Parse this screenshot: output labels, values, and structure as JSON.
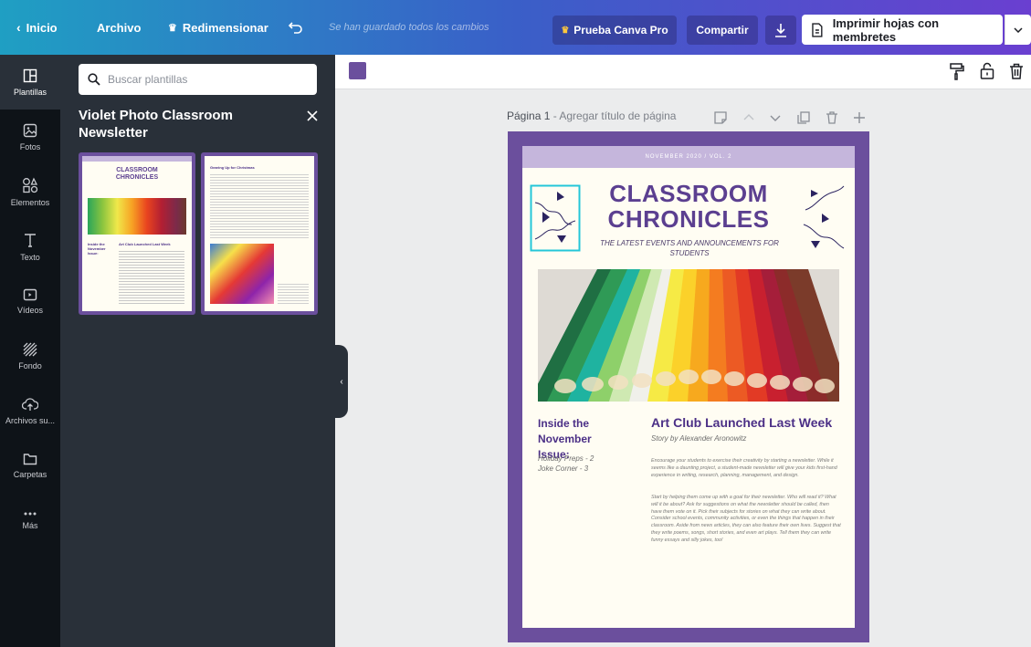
{
  "topbar": {
    "home_label": "Inicio",
    "file_label": "Archivo",
    "resize_label": "Redimensionar",
    "save_status": "Se han guardado todos los cambios",
    "pro_label": "Prueba Canva Pro",
    "share_label": "Compartir",
    "print_label": "Imprimir hojas con membretes"
  },
  "rail": {
    "items": [
      {
        "label": "Plantillas",
        "icon": "templates-icon"
      },
      {
        "label": "Fotos",
        "icon": "photos-icon"
      },
      {
        "label": "Elementos",
        "icon": "elements-icon"
      },
      {
        "label": "Texto",
        "icon": "text-icon"
      },
      {
        "label": "Vídeos",
        "icon": "videos-icon"
      },
      {
        "label": "Fondo",
        "icon": "background-icon"
      },
      {
        "label": "Archivos su...",
        "icon": "uploads-icon"
      },
      {
        "label": "Carpetas",
        "icon": "folders-icon"
      },
      {
        "label": "Más",
        "icon": "more-icon"
      }
    ]
  },
  "panel": {
    "search_placeholder": "Buscar plantillas",
    "title": "Violet Photo Classroom Newsletter",
    "thumb1": {
      "title": "CLASSROOM CHRONICLES",
      "col1": "Inside the November Issue:",
      "col2": "Art Club Launched Last Week"
    },
    "thumb2": {
      "title": "Gearing Up for Christmas"
    }
  },
  "canvas": {
    "page_label": "Página 1",
    "page_title_placeholder": " - Agregar título de página"
  },
  "newsletter": {
    "issue": "NOVEMBER 2020 / VOL. 2",
    "title_line1": "CLASSROOM",
    "title_line2": "CHRONICLES",
    "subtitle": "THE LATEST EVENTS AND ANNOUNCEMENTS FOR STUDENTS",
    "inside_title": "Inside the November Issue:",
    "toc": [
      "Holiday Preps - 2",
      "Joke Corner - 3"
    ],
    "article_title": "Art Club Launched Last Week",
    "byline": "Story by Alexander Aronowitz",
    "para1": "Encourage your students to exercise their creativity by starting a newsletter. While it seems like a daunting project, a student-made newsletter will give your kids first-hand experience in writing, research, planning, management, and design.",
    "para2": "Start by helping them come up with a goal for their newsletter. Who will read it? What will it be about? Ask for suggestions on what the newsletter should be called, then have them vote on it. Pick their subjects for stories on what they can write about. Consider school events, community activities, or even the things that happen in their classroom. Aside from news articles, they can also feature their own lives. Suggest that they write poems, songs, short stories, and even art plays. Tell them they can write funny essays and silly jokes, too!"
  },
  "colors": {
    "accent_purple": "#6b4f9d",
    "title_purple": "#5b3f90",
    "rail_bg": "#0e1318",
    "panel_bg": "#293039",
    "teal_frame": "#24c6d8"
  }
}
